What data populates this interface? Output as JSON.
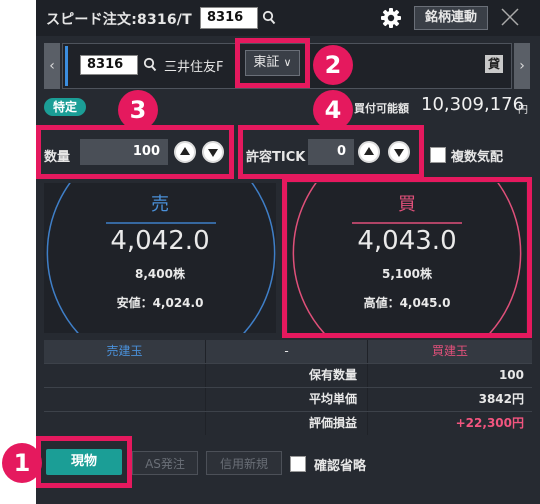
{
  "header": {
    "title": "スピード注文:8316/T",
    "code_value": "8316",
    "brand_link_label": "銘柄連動"
  },
  "symbol_bar": {
    "code_value": "8316",
    "name": "三井住友F",
    "market": "東証",
    "lend_badge": "貸"
  },
  "callouts": [
    "1",
    "2",
    "3",
    "4"
  ],
  "margin": {
    "tag": "特定",
    "buying_power_label": "買付可能額",
    "buying_power_value": "10,309,176",
    "unit": "円"
  },
  "order": {
    "quantity_label": "数量",
    "quantity_value": "100",
    "tick_label": "許容TICK",
    "tick_value": "0",
    "multi_quote_label": "複数気配"
  },
  "sell": {
    "label": "売",
    "price": "4,042.0",
    "volume": "8,400株",
    "extreme": "安値：4,024.0"
  },
  "buy": {
    "label": "買",
    "price": "4,043.0",
    "volume": "5,100株",
    "extreme": "高値：4,045.0"
  },
  "positions": {
    "sell_header": "売建玉",
    "mid_header": "-",
    "buy_header": "買建玉",
    "rows": [
      {
        "label": "保有数量",
        "value": "100"
      },
      {
        "label": "平均単価",
        "value": "3842円"
      },
      {
        "label": "評価損益",
        "value": "+22,300円"
      }
    ]
  },
  "footer": {
    "cash_label": "現物",
    "as_label": "AS発注",
    "margin_new_label": "信用新規",
    "confirm_skip_label": "確認省略"
  },
  "colors": {
    "accent_pink": "#e5195e",
    "teal": "#1b9e96",
    "sell_blue": "#4a90d9",
    "buy_pink": "#e0507a"
  }
}
